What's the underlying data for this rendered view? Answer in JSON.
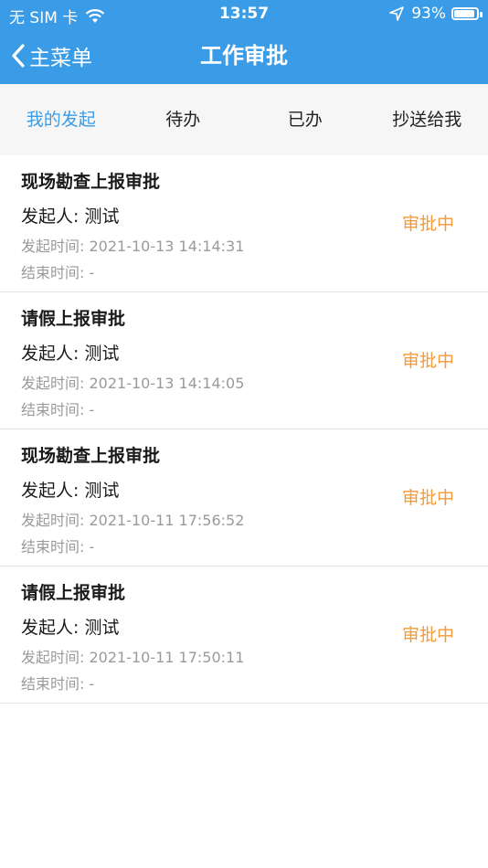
{
  "status_bar": {
    "carrier": "无 SIM 卡",
    "time": "13:57",
    "battery": "93%",
    "battery_level": 0.93
  },
  "nav": {
    "back_label": "主菜单",
    "title": "工作审批"
  },
  "tabs": [
    {
      "label": "我的发起",
      "active": true
    },
    {
      "label": "待办",
      "active": false
    },
    {
      "label": "已办",
      "active": false
    },
    {
      "label": "抄送给我",
      "active": false
    }
  ],
  "colors": {
    "header": "#3a9ce6",
    "active_tab": "#3a9ce6",
    "status_text": "#f39a3a"
  },
  "items": [
    {
      "title": "现场勘查上报审批",
      "initiator": "发起人: 测试",
      "start_time": "发起时间: 2021-10-13 14:14:31",
      "end_time": "结束时间: -",
      "status": "审批中"
    },
    {
      "title": "请假上报审批",
      "initiator": "发起人: 测试",
      "start_time": "发起时间: 2021-10-13 14:14:05",
      "end_time": "结束时间: -",
      "status": "审批中"
    },
    {
      "title": "现场勘查上报审批",
      "initiator": "发起人: 测试",
      "start_time": "发起时间: 2021-10-11 17:56:52",
      "end_time": "结束时间: -",
      "status": "审批中"
    },
    {
      "title": "请假上报审批",
      "initiator": "发起人: 测试",
      "start_time": "发起时间: 2021-10-11 17:50:11",
      "end_time": "结束时间: -",
      "status": "审批中"
    }
  ]
}
